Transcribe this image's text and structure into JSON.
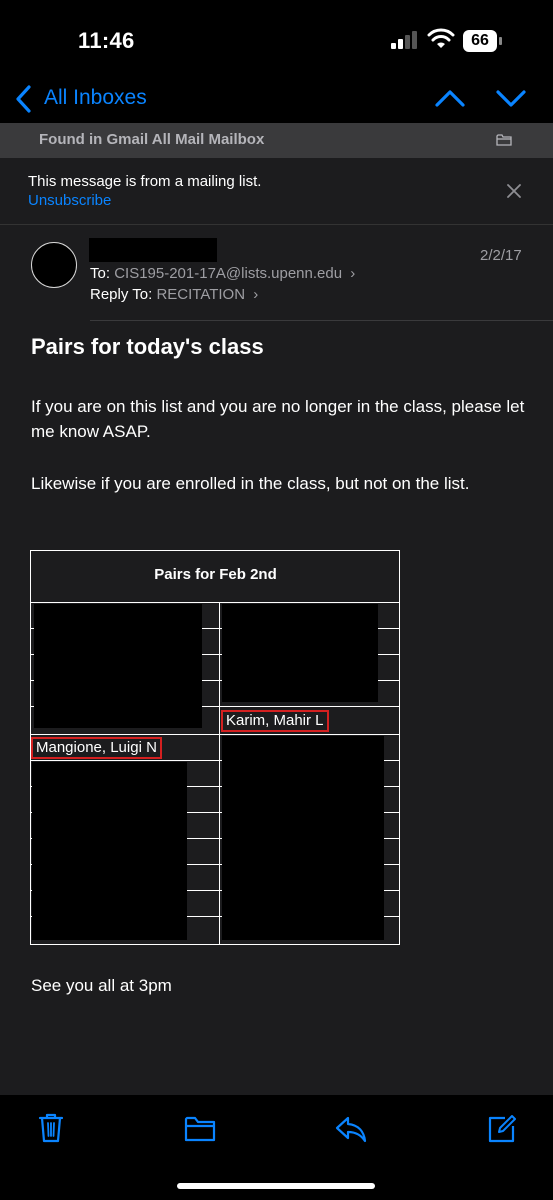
{
  "status_bar": {
    "time": "11:46",
    "battery": "66"
  },
  "nav": {
    "back_label": "All Inboxes"
  },
  "mailbox": {
    "text": "Found in Gmail All Mail Mailbox"
  },
  "banner": {
    "text": "This message is from a mailing list.",
    "unsubscribe": "Unsubscribe"
  },
  "header": {
    "date": "2/2/17",
    "to_label": "To:",
    "to_value": "CIS195-201-17A@lists.upenn.edu",
    "reply_label": "Reply To:",
    "reply_value": "RECITATION"
  },
  "email": {
    "subject": "Pairs for today's class",
    "para1": "If you are on this list and you are no longer in the class, please let me know ASAP.",
    "para2": "Likewise if you are enrolled in the class, but not on the list.",
    "table_title": "Pairs for Feb 2nd",
    "highlighted_names": [
      "Karim, Mahir L",
      "Mangione, Luigi N"
    ],
    "signoff": "See you all at 3pm"
  },
  "icons": [
    "signal-icon",
    "wifi-icon",
    "battery-icon",
    "back-chevron-icon",
    "up-chevron-icon",
    "down-chevron-icon",
    "folder-icon",
    "close-icon",
    "trash-icon",
    "move-folder-icon",
    "reply-icon",
    "compose-icon"
  ],
  "colors": {
    "accent": "#0a84ff",
    "highlight_border": "#d42020",
    "background": "#1c1c1e"
  }
}
